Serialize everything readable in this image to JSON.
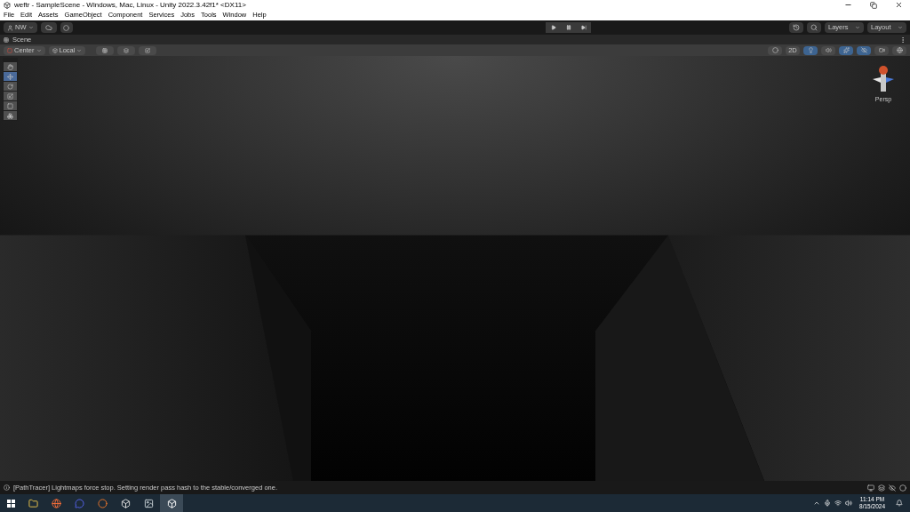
{
  "window": {
    "title": "weftr - SampleScene - Windows, Mac, Linux - Unity 2022.3.42f1* <DX11>"
  },
  "menu": [
    "File",
    "Edit",
    "Assets",
    "GameObject",
    "Component",
    "Services",
    "Jobs",
    "Tools",
    "Window",
    "Help"
  ],
  "toolbar": {
    "account": "NW",
    "play": [
      {
        "kind": "play",
        "selected": false
      },
      {
        "kind": "pause",
        "selected": false
      },
      {
        "kind": "step",
        "selected": false
      }
    ],
    "layers": "Layers",
    "layout": "Layout"
  },
  "scene_tab": {
    "label": "Scene"
  },
  "scene_toolbar": {
    "pivot": "Center",
    "space": "Local",
    "toggles": [
      {
        "kind": "shading",
        "selected": false
      },
      {
        "kind": "dimension",
        "label": "2D",
        "selected": false
      },
      {
        "kind": "lighting",
        "selected": true
      },
      {
        "kind": "audio",
        "selected": false
      },
      {
        "kind": "effects",
        "selected": true
      },
      {
        "kind": "hidden",
        "selected": true
      },
      {
        "kind": "camera",
        "selected": false
      },
      {
        "kind": "gizmos",
        "selected": false
      }
    ]
  },
  "tools": [
    {
      "kind": "hand",
      "selected": false
    },
    {
      "kind": "move",
      "selected": true
    },
    {
      "kind": "rotate",
      "selected": false
    },
    {
      "kind": "scale",
      "selected": false
    },
    {
      "kind": "rect",
      "selected": false
    },
    {
      "kind": "transform",
      "selected": false
    }
  ],
  "gizmo": {
    "projection": "Persp"
  },
  "status_bar": {
    "message": "[PathTracer] Lightmaps force stop. Setting render pass hash to the stable/converged one."
  },
  "taskbar": {
    "apps": [
      {
        "kind": "explorer",
        "selected": false
      },
      {
        "kind": "browser",
        "selected": false
      },
      {
        "kind": "chat",
        "selected": false
      },
      {
        "kind": "blender",
        "selected": false
      },
      {
        "kind": "hub",
        "selected": false
      },
      {
        "kind": "photos",
        "selected": false
      },
      {
        "kind": "unity",
        "selected": true
      }
    ],
    "time": "11:14 PM",
    "date": "8/15/2024"
  }
}
